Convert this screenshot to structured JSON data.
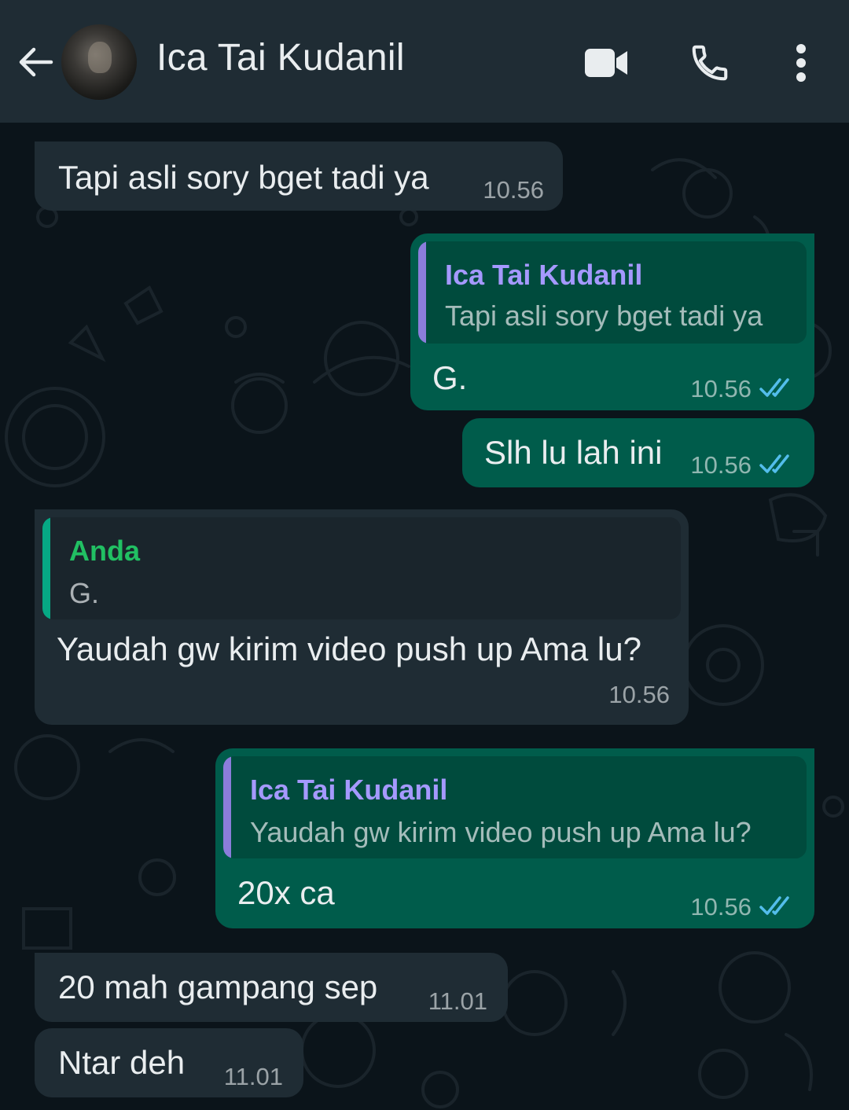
{
  "header": {
    "contact_name": "Ica Tai Kudanil",
    "icons": [
      "back-arrow-icon",
      "video-call-icon",
      "phone-icon",
      "more-vert-icon"
    ]
  },
  "colors": {
    "header_bg": "#1f2c34",
    "incoming_bubble": "#1f2c34",
    "outgoing_bubble": "#005c4b",
    "chat_bg": "#0b141a",
    "quote_outgoing_bar": "#8b7ddb",
    "quote_incoming_bar": "#06a884",
    "read_ticks": "#53bdeb"
  },
  "messages": [
    {
      "text": "Tapi asli sory bget tadi ya",
      "time": "10.56"
    },
    {
      "quote_name": "Ica Tai Kudanil",
      "quote_text": "Tapi asli sory bget tadi ya",
      "text": "G.",
      "time": "10.56"
    },
    {
      "text": "Slh lu lah ini",
      "time": "10.56"
    },
    {
      "quote_name": "Anda",
      "quote_text": "G.",
      "text": "Yaudah gw kirim video push up Ama lu?",
      "time": "10.56"
    },
    {
      "quote_name": "Ica Tai Kudanil",
      "quote_text": "Yaudah gw kirim video push up Ama lu?",
      "text": "20x ca",
      "time": "10.56"
    },
    {
      "text": "20 mah gampang sep",
      "time": "11.01"
    },
    {
      "text": "Ntar deh",
      "time": "11.01"
    }
  ]
}
